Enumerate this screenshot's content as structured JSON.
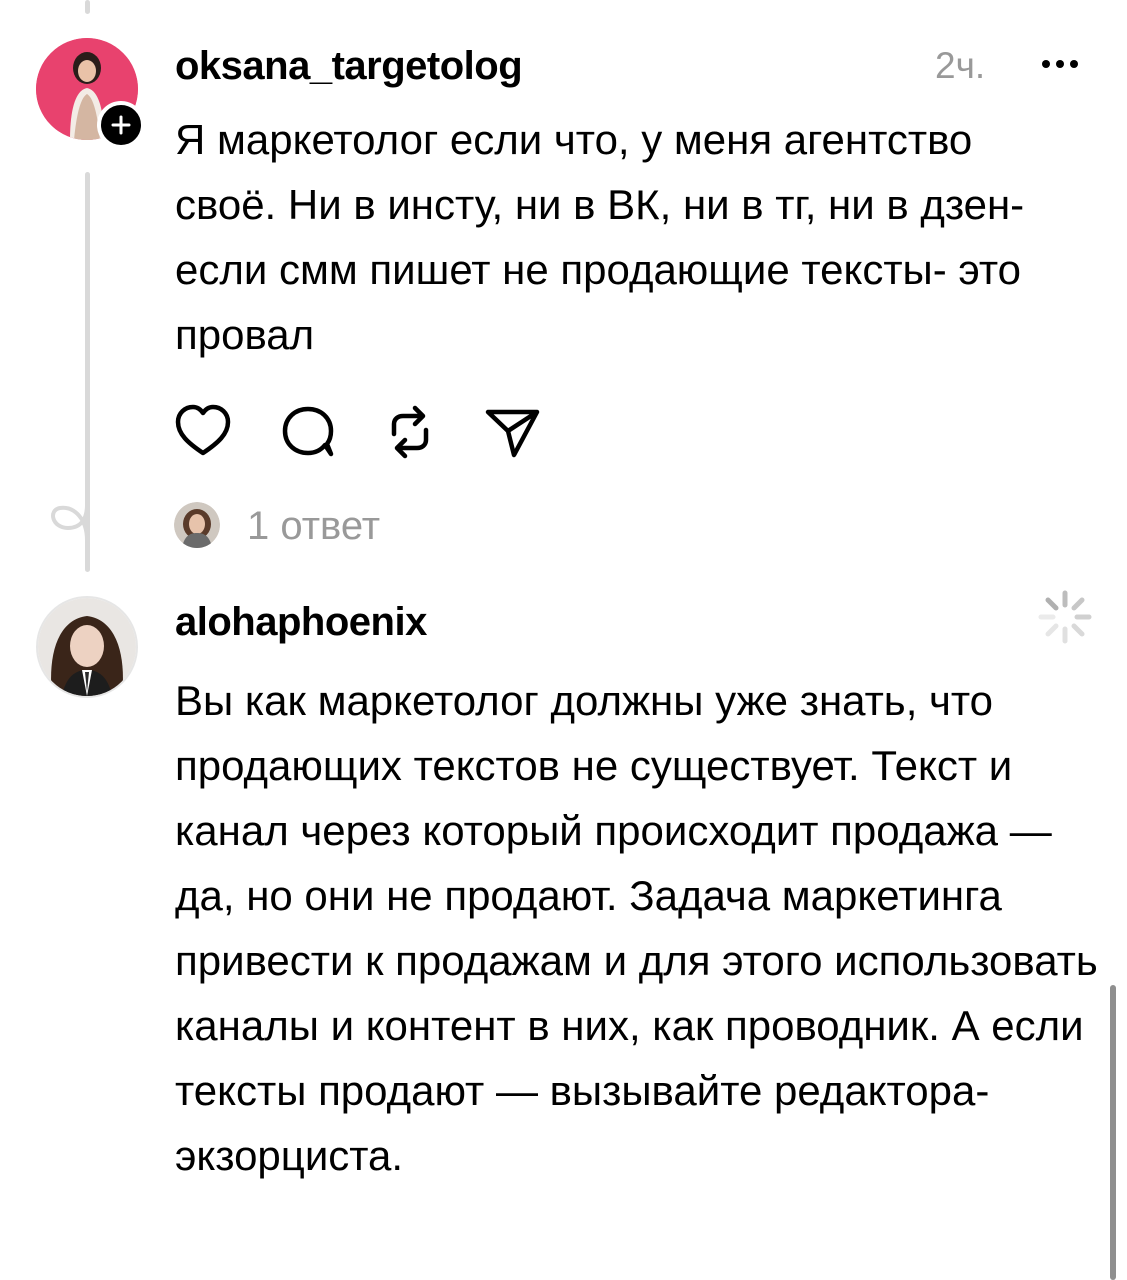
{
  "comments": [
    {
      "username": "oksana_targetolog",
      "timestamp": "2ч.",
      "text": "Я маркетолог если что, у меня агентство своё. Ни в инсту, ни в ВК, ни в тг, ни в дзен- если смм пишет не продающие тексты- это провал",
      "replies_label": "1 ответ",
      "actions": [
        "heart-icon",
        "comment-icon",
        "repost-icon",
        "share-icon"
      ],
      "avatar_color": "#e8426e"
    },
    {
      "username": "alohaphoenix",
      "text": "Вы как маркетолог должны уже знать, что продающих текстов не существует. Текст и канал через который происходит продажа — да, но они не продают. Задача маркетинга привести к продажам и для этого использовать каналы и контент в них, как проводник. А если тексты продают — вызывайте редактора-экзорциста.",
      "status_icon": "loading-spinner-icon"
    }
  ],
  "colors": {
    "text": "#000000",
    "muted": "#999999",
    "thread_line": "#d9d9d9",
    "avatar_ring": "#e8426e"
  }
}
